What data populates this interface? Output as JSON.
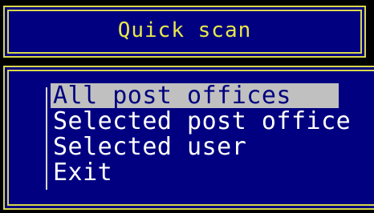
{
  "title": "Quick scan",
  "menu": {
    "items": [
      {
        "label": "All post offices",
        "selected": true
      },
      {
        "label": "Selected post office",
        "selected": false
      },
      {
        "label": "Selected user",
        "selected": false
      },
      {
        "label": "Exit",
        "selected": false
      }
    ]
  },
  "colors": {
    "background": "#000080",
    "border": "#d8d84a",
    "title_text": "#e8e84a",
    "menu_text": "#ffffff",
    "highlight_bg": "#c0c0c0",
    "highlight_text": "#000080"
  }
}
